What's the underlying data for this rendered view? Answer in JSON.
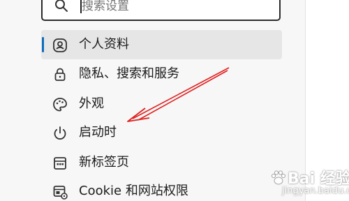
{
  "search": {
    "placeholder": "搜索设置"
  },
  "nav": {
    "items": [
      {
        "label": "个人资料",
        "icon": "profile-icon",
        "selected": true
      },
      {
        "label": "隐私、搜索和服务",
        "icon": "lock-icon",
        "selected": false
      },
      {
        "label": "外观",
        "icon": "palette-icon",
        "selected": false
      },
      {
        "label": "启动时",
        "icon": "power-icon",
        "selected": false
      },
      {
        "label": "新标签页",
        "icon": "new-tab-icon",
        "selected": false
      },
      {
        "label": "Cookie 和网站权限",
        "icon": "site-permissions-icon",
        "selected": false
      }
    ]
  },
  "colors": {
    "accent": "#0f6cbd",
    "annotation_arrow": "#e02020",
    "selected_bg": "#e6e6e6"
  },
  "watermark": {
    "brand": "Bai 经验",
    "url": "jingyan.baidu.com"
  }
}
